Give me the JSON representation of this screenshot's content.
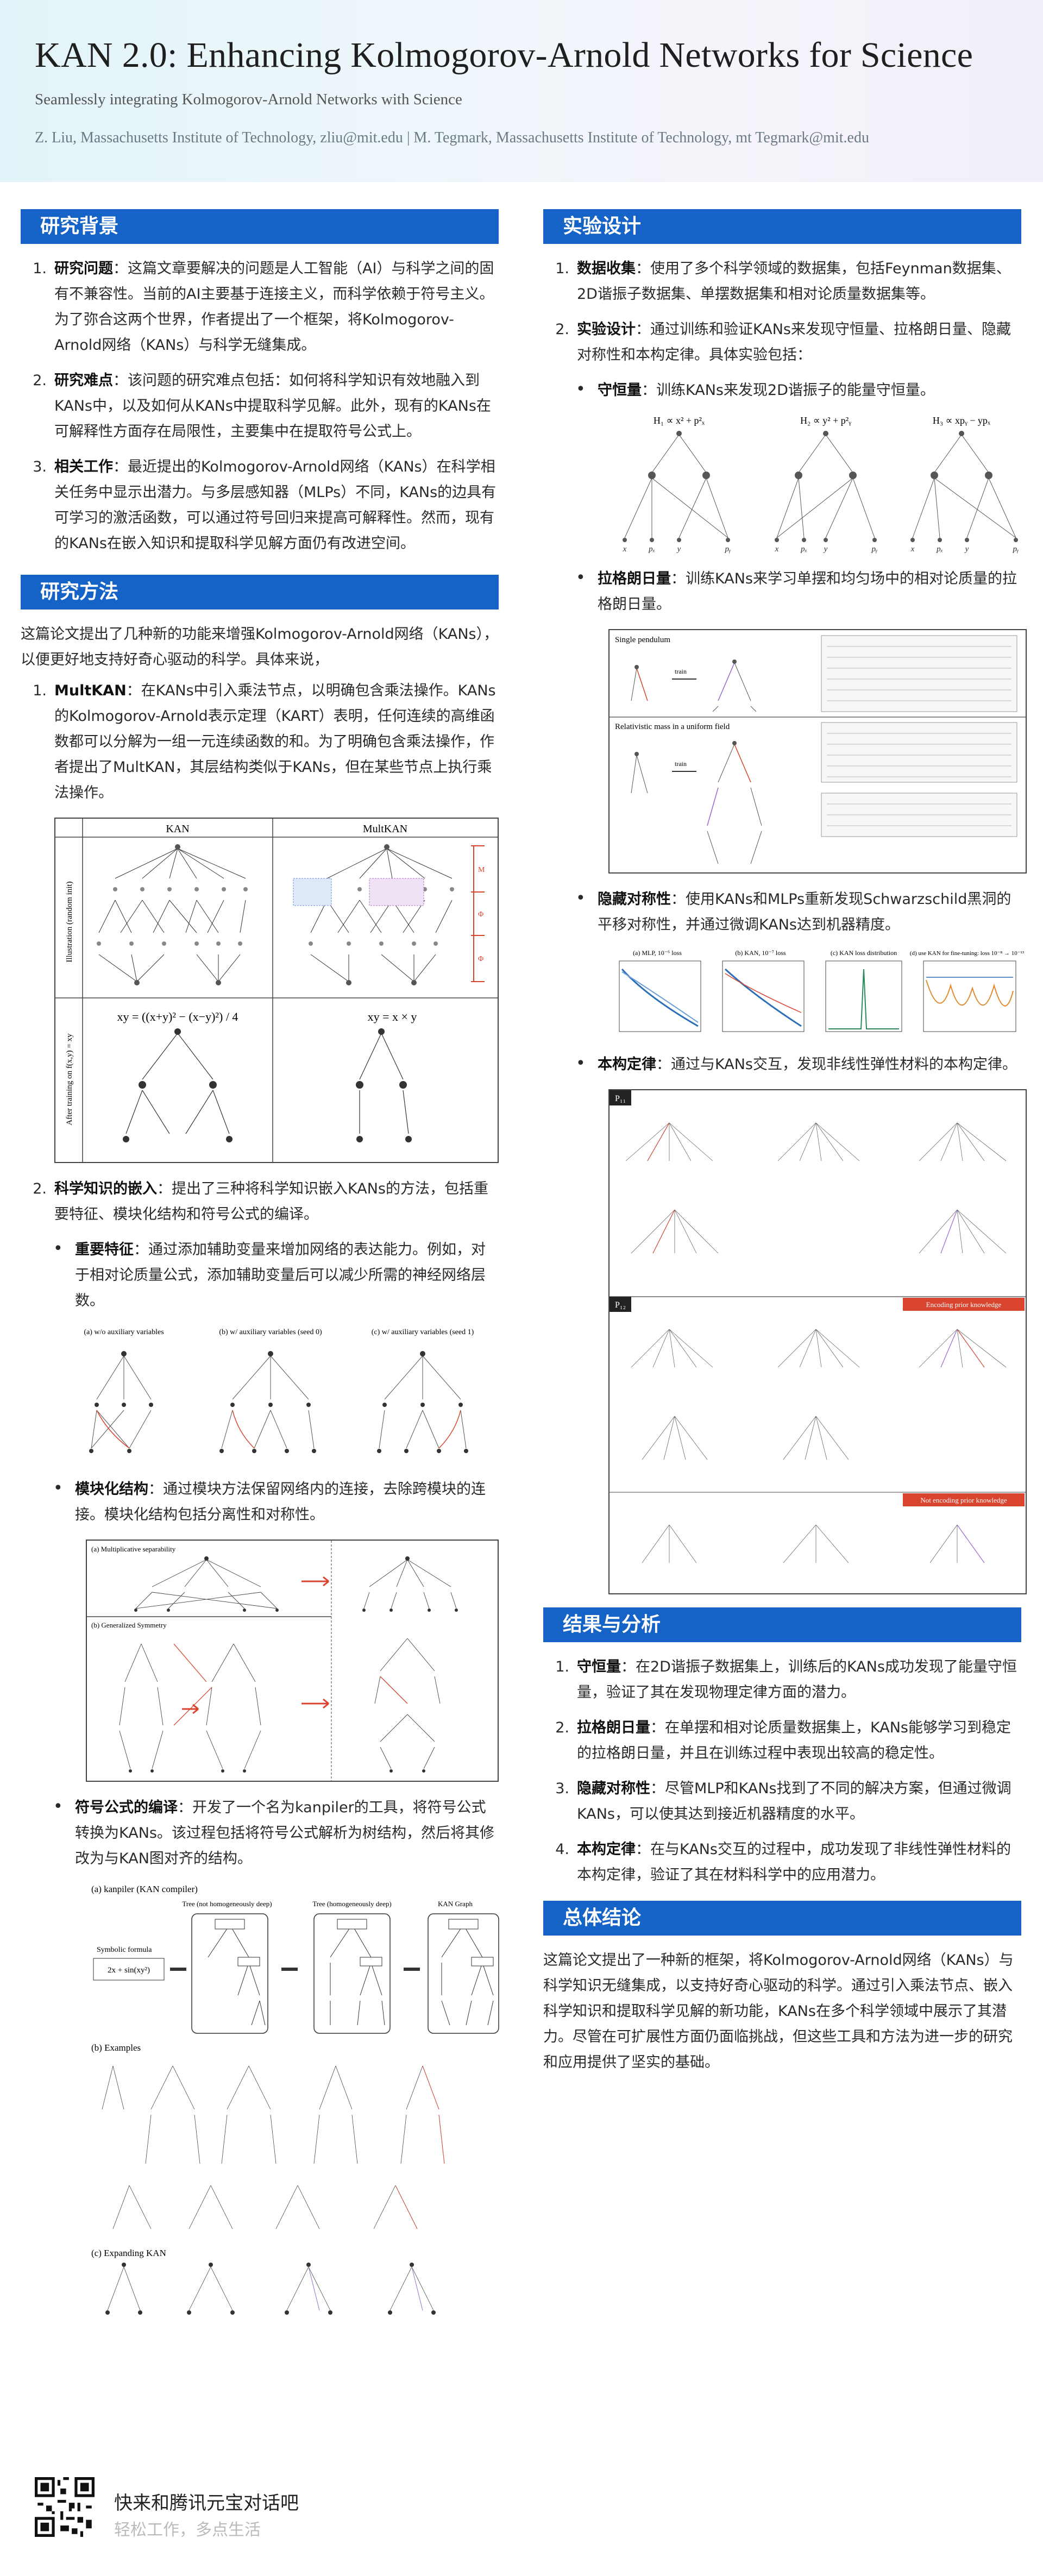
{
  "header": {
    "title": "KAN 2.0: Enhancing Kolmogorov-Arnold Networks for Science",
    "subtitle": "Seamlessly integrating Kolmogorov-Arnold Networks with Science",
    "authors": "Z. Liu, Massachusetts Institute of Technology, zliu@mit.edu | M. Tegmark, Massachusetts Institute of Technology, mt Tegmark@mit.edu"
  },
  "background": {
    "title": "研究背景",
    "items": [
      {
        "num": "1.",
        "head": "研究问题",
        "text": "：这篇文章要解决的问题是人工智能（AI）与科学之间的固有不兼容性。当前的AI主要基于连接主义，而科学依赖于符号主义。为了弥合这两个世界，作者提出了一个框架，将Kolmogorov-Arnold网络（KANs）与科学无缝集成。"
      },
      {
        "num": "2.",
        "head": "研究难点",
        "text": "：该问题的研究难点包括：如何将科学知识有效地融入到KANs中，以及如何从KANs中提取科学见解。此外，现有的KANs在可解释性方面存在局限性，主要集中在提取符号公式上。"
      },
      {
        "num": "3.",
        "head": "相关工作",
        "text": "：最近提出的Kolmogorov-Arnold网络（KANs）在科学相关任务中显示出潜力。与多层感知器（MLPs）不同，KANs的边具有可学习的激活函数，可以通过符号回归来提高可解释性。然而，现有的KANs在嵌入知识和提取科学见解方面仍有改进空间。"
      }
    ]
  },
  "methods": {
    "title": "研究方法",
    "intro": "这篇论文提出了几种新的功能来增强Kolmogorov-Arnold网络（KANs），以便更好地支持好奇心驱动的科学。具体来说，",
    "item1": {
      "num": "1.",
      "head": "MultKAN",
      "text": "：在KANs中引入乘法节点，以明确包含乘法操作。KANs的Kolmogorov-Arnold表示定理（KART）表明，任何连续的高维函数都可以分解为一组一元连续函数的和。为了明确包含乘法操作，作者提出了MultKAN，其层结构类似于KANs，但在某些节点上执行乘法操作。"
    },
    "fig1": {
      "col_kan": "KAN",
      "col_mult": "MultKAN",
      "row1": "Illustration (random init)",
      "row2": "After training on f(x,y) = xy",
      "formula_kan": "xy = ((x+y)² − (x−y)²) / 4",
      "formula_mult": "xy = x × y"
    },
    "item2": {
      "num": "2.",
      "head": "科学知识的嵌入",
      "text": "：提出了三种将科学知识嵌入KANs的方法，包括重要特征、模块化结构和符号公式的编译。"
    },
    "sub1": {
      "head": "重要特征",
      "text": "：通过添加辅助变量来增加网络的表达能力。例如，对于相对论质量公式，添加辅助变量后可以减少所需的神经网络层数。"
    },
    "fig2": {
      "a": "(a) w/o auxiliary variables",
      "b": "(b) w/ auxiliary variables (seed 0)",
      "c": "(c) w/ auxiliary variables (seed 1)"
    },
    "sub2": {
      "head": "模块化结构",
      "text": "：通过模块方法保留网络内的连接，去除跨模块的连接。模块化结构包括分离性和对称性。"
    },
    "fig3": {
      "a": "(a) Multiplicative separability",
      "b": "(b) Generalized Symmetry"
    },
    "sub3": {
      "head": "符号公式的编译",
      "text": "：开发了一个名为kanpiler的工具，将符号公式转换为KANs。该过程包括将符号公式解析为树结构，然后将其修改为与KAN图对齐的结构。"
    },
    "fig4": {
      "a": "(a) kanpiler (KAN compiler)",
      "b": "(b) Examples",
      "c": "(c) Expanding KAN",
      "formula": "Symbolic formula",
      "t1": "Tree (not homogeneously deep)",
      "t2": "Tree (homogeneously deep)",
      "t3": "KAN Graph"
    }
  },
  "experiment": {
    "title": "实验设计",
    "item1": {
      "num": "1.",
      "head": "数据收集",
      "text": "：使用了多个科学领域的数据集，包括Feynman数据集、2D谐振子数据集、单摆数据集和相对论质量数据集等。"
    },
    "item2": {
      "num": "2.",
      "head": "实验设计",
      "text": "：通过训练和验证KANs来发现守恒量、拉格朗日量、隐藏对称性和本构定律。具体实验包括："
    },
    "sub1": {
      "head": "守恒量",
      "text": "：训练KANs来发现2D谐振子的能量守恒量。"
    },
    "fig_cons": {
      "h1": "H₁ ∝ x² + p²ₓ",
      "h2": "H₂ ∝ y² + p²ᵧ",
      "h3": "H₃ ∝ xpᵧ − ypₓ"
    },
    "sub2": {
      "head": "拉格朗日量",
      "text": "：训练KANs来学习单摆和均匀场中的相对论质量的拉格朗日量。"
    },
    "fig_lag": {
      "r1": "Single pendulum",
      "r2": "Relativistic mass in a uniform field",
      "train": "train"
    },
    "sub3": {
      "head": "隐藏对称性",
      "text": "：使用KANs和MLPs重新发现Schwarzschild黑洞的平移对称性，并通过微调KANs达到机器精度。"
    },
    "fig_sym": {
      "a": "(a) MLP, 10⁻⁶ loss",
      "b": "(b) KAN, 10⁻⁷ loss",
      "c": "(c) KAN loss distribution",
      "d": "(d) use KAN for fine-tuning: loss 10⁻⁸ → 10⁻¹³"
    },
    "sub4": {
      "head": "本构定律",
      "text": "：通过与KANs交互，发现非线性弹性材料的本构定律。"
    },
    "fig_const": {
      "p11": "P₁₁",
      "p12": "P₁₂",
      "enc": "Encoding prior knowledge",
      "noenc": "Not encoding prior knowledge"
    }
  },
  "results": {
    "title": "结果与分析",
    "items": [
      {
        "num": "1.",
        "head": "守恒量",
        "text": "：在2D谐振子数据集上，训练后的KANs成功发现了能量守恒量，验证了其在发现物理定律方面的潜力。"
      },
      {
        "num": "2.",
        "head": "拉格朗日量",
        "text": "：在单摆和相对论质量数据集上，KANs能够学习到稳定的拉格朗日量，并且在训练过程中表现出较高的稳定性。"
      },
      {
        "num": "3.",
        "head": "隐藏对称性",
        "text": "：尽管MLP和KANs找到了不同的解决方案，但通过微调KANs，可以使其达到接近机器精度的水平。"
      },
      {
        "num": "4.",
        "head": "本构定律",
        "text": "：在与KANs交互的过程中，成功发现了非线性弹性材料的本构定律，验证了其在材料科学中的应用潜力。"
      }
    ]
  },
  "conclusion": {
    "title": "总体结论",
    "text": "这篇论文提出了一种新的框架，将Kolmogorov-Arnold网络（KANs）与科学知识无缝集成，以支持好奇心驱动的科学。通过引入乘法节点、嵌入科学知识和提取科学见解的新功能，KANs在多个科学领域中展示了其潜力。尽管在可扩展性方面仍面临挑战，但这些工具和方法为进一步的研究和应用提供了坚实的基础。"
  },
  "footer": {
    "title": "快来和腾讯元宝对话吧",
    "subtitle": "轻松工作，多点生活"
  },
  "colors": {
    "section_bar": "#1663c7",
    "accent_red": "#d9442f",
    "accent_purple": "#8f63c9"
  }
}
